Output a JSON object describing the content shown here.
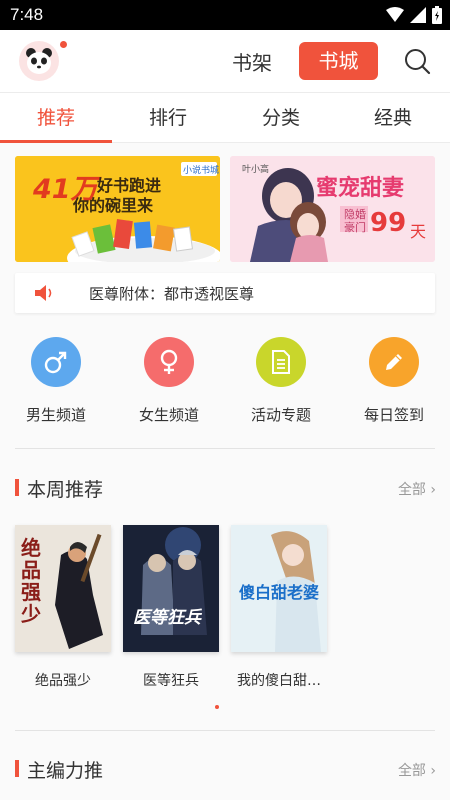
{
  "status": {
    "time": "7:48"
  },
  "header": {
    "shelf_label": "书架",
    "store_label": "书城"
  },
  "tabs": [
    {
      "label": "推荐",
      "active": true
    },
    {
      "label": "排行",
      "active": false
    },
    {
      "label": "分类",
      "active": false
    },
    {
      "label": "经典",
      "active": false
    }
  ],
  "banners": {
    "left": {
      "number": "41万",
      "line1": "好书跑进",
      "line2": "你的碗里来",
      "badge": "小说书城"
    },
    "right": {
      "author": "叶小高",
      "title": "蜜宠甜妻",
      "tag1": "隐婚",
      "tag2": "豪门",
      "days": "99",
      "days_unit": "天"
    }
  },
  "notice": {
    "text": "医尊附体：都市透视医尊"
  },
  "channels": [
    {
      "label": "男生频道",
      "icon": "male-icon",
      "color": "#5da8ee"
    },
    {
      "label": "女生频道",
      "icon": "female-icon",
      "color": "#f56c6c"
    },
    {
      "label": "活动专题",
      "icon": "document-icon",
      "color": "#c9d62b"
    },
    {
      "label": "每日签到",
      "icon": "pencil-icon",
      "color": "#f8a42b"
    }
  ],
  "sections": {
    "weekly": {
      "title": "本周推荐",
      "more": "全部 ›"
    },
    "editor": {
      "title": "主编力推",
      "more": "全部 ›"
    }
  },
  "books": [
    {
      "title": "绝品强少",
      "cover_text": "绝品强少"
    },
    {
      "title": "医等狂兵",
      "cover_text": "医等狂兵"
    },
    {
      "title": "我的傻白甜…",
      "cover_text": "傻白甜老婆"
    }
  ],
  "colors": {
    "accent": "#f0533c"
  }
}
